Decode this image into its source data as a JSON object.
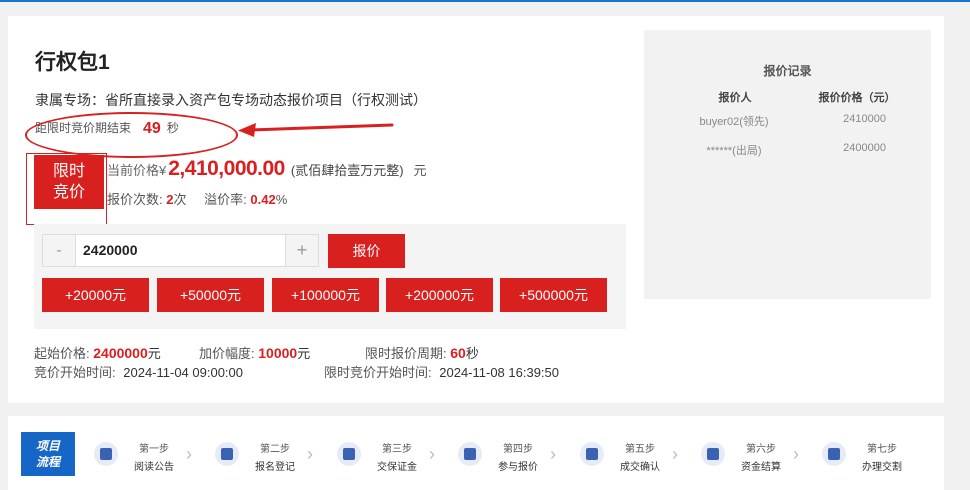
{
  "title": "行权包1",
  "dept": "隶属专场：省所直接录入资产包专场动态报价项目（行权测试）",
  "countdown": {
    "label": "距限时竞价期结束",
    "value": "49",
    "unit": "秒"
  },
  "tag": {
    "line1": "限时",
    "line2": "竞价"
  },
  "price": {
    "label": "当前价格",
    "currency": "¥",
    "value": "2,410,000.00",
    "cn": "(贰佰肆拾壹万元整)",
    "unit": "元"
  },
  "stats": {
    "count_label": "报价次数:",
    "count": "2",
    "count_unit": "次",
    "premium_label": "溢价率:",
    "premium": "0.42",
    "premium_unit": "%"
  },
  "bid": {
    "minus": "-",
    "plus": "+",
    "value": "2420000",
    "submit": "报价"
  },
  "increments": [
    "+20000元",
    "+50000元",
    "+100000元",
    "+200000元",
    "+500000元"
  ],
  "info": {
    "start_price_label": "起始价格:",
    "start_price": "2400000",
    "start_price_unit": "元",
    "step_label": "加价幅度:",
    "step": "10000",
    "step_unit": "元",
    "period_label": "限时报价周期:",
    "period": "60",
    "period_unit": "秒",
    "bid_start_label": "竞价开始时间:",
    "bid_start": "2024-11-04 09:00:00",
    "limited_start_label": "限时竞价开始时间:",
    "limited_start": "2024-11-08 16:39:50"
  },
  "records": {
    "title": "报价记录",
    "col_bidder": "报价人",
    "col_price": "报价价格（元）",
    "rows": [
      {
        "bidder": "buyer02(领先)",
        "price": "2410000"
      },
      {
        "bidder": "******(出局)",
        "price": "2400000"
      }
    ]
  },
  "flow": {
    "badge_line1": "项目",
    "badge_line2": "流程",
    "steps": [
      {
        "no": "第一步",
        "name": "阅读公告"
      },
      {
        "no": "第二步",
        "name": "报名登记"
      },
      {
        "no": "第三步",
        "name": "交保证金"
      },
      {
        "no": "第四步",
        "name": "参与报价"
      },
      {
        "no": "第五步",
        "name": "成交确认"
      },
      {
        "no": "第六步",
        "name": "资金结算"
      },
      {
        "no": "第七步",
        "name": "办理交割"
      }
    ],
    "chevron": "›"
  },
  "colors": {
    "accent_red": "#d8201e",
    "brand_blue": "#1666c8"
  }
}
